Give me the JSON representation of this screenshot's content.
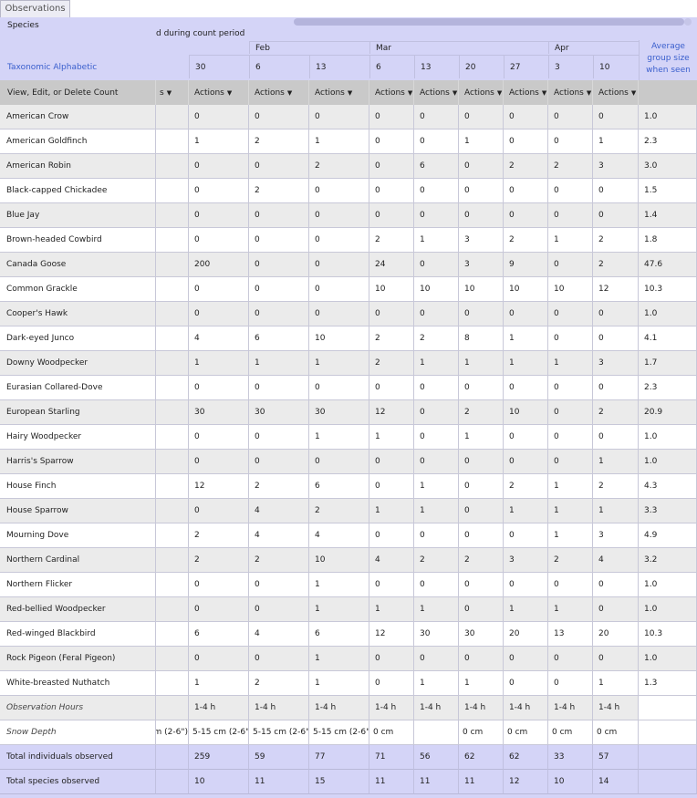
{
  "tab": "Observations",
  "header": {
    "species_label": "Species",
    "period_text": "d during count period",
    "taxonomic_link": "Taxonomic Alphabetic",
    "average_label": "Average group size when seen",
    "months": [
      {
        "label": "Feb"
      },
      {
        "label": "Mar"
      },
      {
        "label": "Apr"
      }
    ],
    "days": [
      "30",
      "6",
      "13",
      "6",
      "13",
      "20",
      "27",
      "3",
      "10"
    ],
    "actions_label": "View, Edit, or Delete Count",
    "partial_action": "s",
    "action_button": "Actions"
  },
  "rows": [
    {
      "species": "American Crow",
      "counts": [
        "0",
        "0",
        "0",
        "0",
        "0",
        "0",
        "0",
        "0",
        "0"
      ],
      "avg": "1.0"
    },
    {
      "species": "American Goldfinch",
      "counts": [
        "1",
        "2",
        "1",
        "0",
        "0",
        "1",
        "0",
        "0",
        "1"
      ],
      "avg": "2.3"
    },
    {
      "species": "American Robin",
      "counts": [
        "0",
        "0",
        "2",
        "0",
        "6",
        "0",
        "2",
        "2",
        "3"
      ],
      "avg": "3.0"
    },
    {
      "species": "Black-capped Chickadee",
      "counts": [
        "0",
        "2",
        "0",
        "0",
        "0",
        "0",
        "0",
        "0",
        "0"
      ],
      "avg": "1.5"
    },
    {
      "species": "Blue Jay",
      "counts": [
        "0",
        "0",
        "0",
        "0",
        "0",
        "0",
        "0",
        "0",
        "0"
      ],
      "avg": "1.4"
    },
    {
      "species": "Brown-headed Cowbird",
      "counts": [
        "0",
        "0",
        "0",
        "2",
        "1",
        "3",
        "2",
        "1",
        "2"
      ],
      "avg": "1.8"
    },
    {
      "species": "Canada Goose",
      "counts": [
        "200",
        "0",
        "0",
        "24",
        "0",
        "3",
        "9",
        "0",
        "2"
      ],
      "avg": "47.6"
    },
    {
      "species": "Common Grackle",
      "counts": [
        "0",
        "0",
        "0",
        "10",
        "10",
        "10",
        "10",
        "10",
        "12"
      ],
      "avg": "10.3"
    },
    {
      "species": "Cooper's Hawk",
      "counts": [
        "0",
        "0",
        "0",
        "0",
        "0",
        "0",
        "0",
        "0",
        "0"
      ],
      "avg": "1.0"
    },
    {
      "species": "Dark-eyed Junco",
      "counts": [
        "4",
        "6",
        "10",
        "2",
        "2",
        "8",
        "1",
        "0",
        "0"
      ],
      "avg": "4.1"
    },
    {
      "species": "Downy Woodpecker",
      "counts": [
        "1",
        "1",
        "1",
        "2",
        "1",
        "1",
        "1",
        "1",
        "3"
      ],
      "avg": "1.7"
    },
    {
      "species": "Eurasian Collared-Dove",
      "counts": [
        "0",
        "0",
        "0",
        "0",
        "0",
        "0",
        "0",
        "0",
        "0"
      ],
      "avg": "2.3"
    },
    {
      "species": "European Starling",
      "counts": [
        "30",
        "30",
        "30",
        "12",
        "0",
        "2",
        "10",
        "0",
        "2"
      ],
      "avg": "20.9"
    },
    {
      "species": "Hairy Woodpecker",
      "counts": [
        "0",
        "0",
        "1",
        "1",
        "0",
        "1",
        "0",
        "0",
        "0"
      ],
      "avg": "1.0"
    },
    {
      "species": "Harris's Sparrow",
      "counts": [
        "0",
        "0",
        "0",
        "0",
        "0",
        "0",
        "0",
        "0",
        "1"
      ],
      "avg": "1.0"
    },
    {
      "species": "House Finch",
      "counts": [
        "12",
        "2",
        "6",
        "0",
        "1",
        "0",
        "2",
        "1",
        "2"
      ],
      "avg": "4.3"
    },
    {
      "species": "House Sparrow",
      "counts": [
        "0",
        "4",
        "2",
        "1",
        "1",
        "0",
        "1",
        "1",
        "1"
      ],
      "avg": "3.3"
    },
    {
      "species": "Mourning Dove",
      "counts": [
        "2",
        "4",
        "4",
        "0",
        "0",
        "0",
        "0",
        "1",
        "3"
      ],
      "avg": "4.9"
    },
    {
      "species": "Northern Cardinal",
      "counts": [
        "2",
        "2",
        "10",
        "4",
        "2",
        "2",
        "3",
        "2",
        "4"
      ],
      "avg": "3.2"
    },
    {
      "species": "Northern Flicker",
      "counts": [
        "0",
        "0",
        "1",
        "0",
        "0",
        "0",
        "0",
        "0",
        "0"
      ],
      "avg": "1.0"
    },
    {
      "species": "Red-bellied Woodpecker",
      "counts": [
        "0",
        "0",
        "1",
        "1",
        "1",
        "0",
        "1",
        "1",
        "0"
      ],
      "avg": "1.0"
    },
    {
      "species": "Red-winged Blackbird",
      "counts": [
        "6",
        "4",
        "6",
        "12",
        "30",
        "30",
        "20",
        "13",
        "20"
      ],
      "avg": "10.3"
    },
    {
      "species": "Rock Pigeon (Feral Pigeon)",
      "counts": [
        "0",
        "0",
        "1",
        "0",
        "0",
        "0",
        "0",
        "0",
        "0"
      ],
      "avg": "1.0"
    },
    {
      "species": "White-breasted Nuthatch",
      "counts": [
        "1",
        "2",
        "1",
        "0",
        "1",
        "1",
        "0",
        "0",
        "1"
      ],
      "avg": "1.3"
    }
  ],
  "observation_hours": {
    "label": "Observation Hours",
    "values": [
      "1-4 h",
      "1-4 h",
      "1-4 h",
      "1-4 h",
      "1-4 h",
      "1-4 h",
      "1-4 h",
      "1-4 h",
      "1-4 h"
    ]
  },
  "snow_depth": {
    "label": "Snow Depth",
    "partial": "m (2-6\")",
    "values": [
      "5-15 cm (2-6\")",
      "5-15 cm (2-6\")",
      "5-15 cm (2-6\")",
      "0 cm",
      "",
      "0 cm",
      "0 cm",
      "0 cm",
      "0 cm"
    ]
  },
  "totals": {
    "individuals_label": "Total individuals observed",
    "individuals": [
      "259",
      "59",
      "77",
      "71",
      "56",
      "62",
      "62",
      "33",
      "57"
    ],
    "species_label": "Total species observed",
    "species": [
      "10",
      "11",
      "15",
      "11",
      "11",
      "11",
      "12",
      "10",
      "14"
    ]
  }
}
